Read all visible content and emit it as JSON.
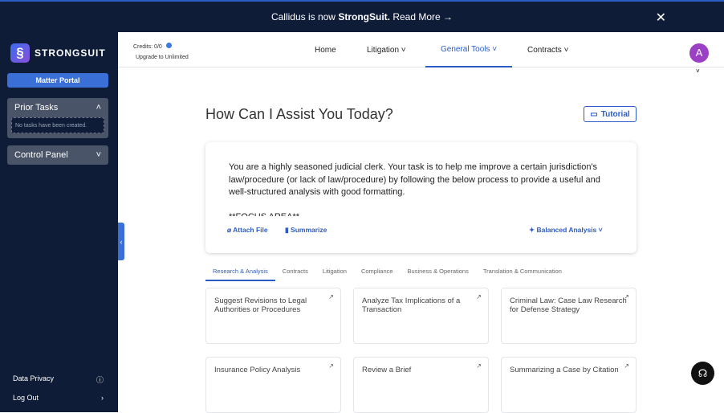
{
  "banner": {
    "text": "Callidus is now ",
    "brand": "StrongSuit.",
    "link": "Read More →"
  },
  "sidebar": {
    "logo": "STRONGSUIT",
    "matter_portal": "Matter Portal",
    "prior_tasks": "Prior Tasks",
    "no_tasks": "No tasks have been created.",
    "control_panel": "Control Panel",
    "data_privacy": "Data Privacy",
    "log_out": "Log Out"
  },
  "header": {
    "credits": "Credits: 0/0",
    "upgrade": "Upgrade to Unlimited",
    "nav": [
      "Home",
      "Litigation",
      "General Tools",
      "Contracts"
    ],
    "active_nav": "General Tools",
    "avatar": "A"
  },
  "main": {
    "title": "How Can I Assist You Today?",
    "tutorial": "Tutorial",
    "prompt": "You are a highly seasoned judicial clerk. Your task is to help me improve a certain jurisdiction's law/procedure (or lack of law/procedure) by following the below process to provide a useful and well-structured analysis with good formatting.\n\n**FOCUS AREA**",
    "attach": "Attach File",
    "summarize": "Summarize",
    "mode": "Balanced Analysis",
    "tabs": [
      "Research & Analysis",
      "Contracts",
      "Litigation",
      "Compliance",
      "Business & Operations",
      "Translation & Communication"
    ],
    "tiles": [
      "Suggest Revisions to Legal Authorities or Procedures",
      "Analyze Tax Implications of a Transaction",
      "Criminal Law: Case Law Research for Defense Strategy",
      "Insurance Policy Analysis",
      "Review a Brief",
      "Summarizing a Case by Citation"
    ]
  },
  "colors": {
    "sidebar": "#0f1c38",
    "accent": "#2c5cc5",
    "avatar": "#9b3fc4"
  }
}
